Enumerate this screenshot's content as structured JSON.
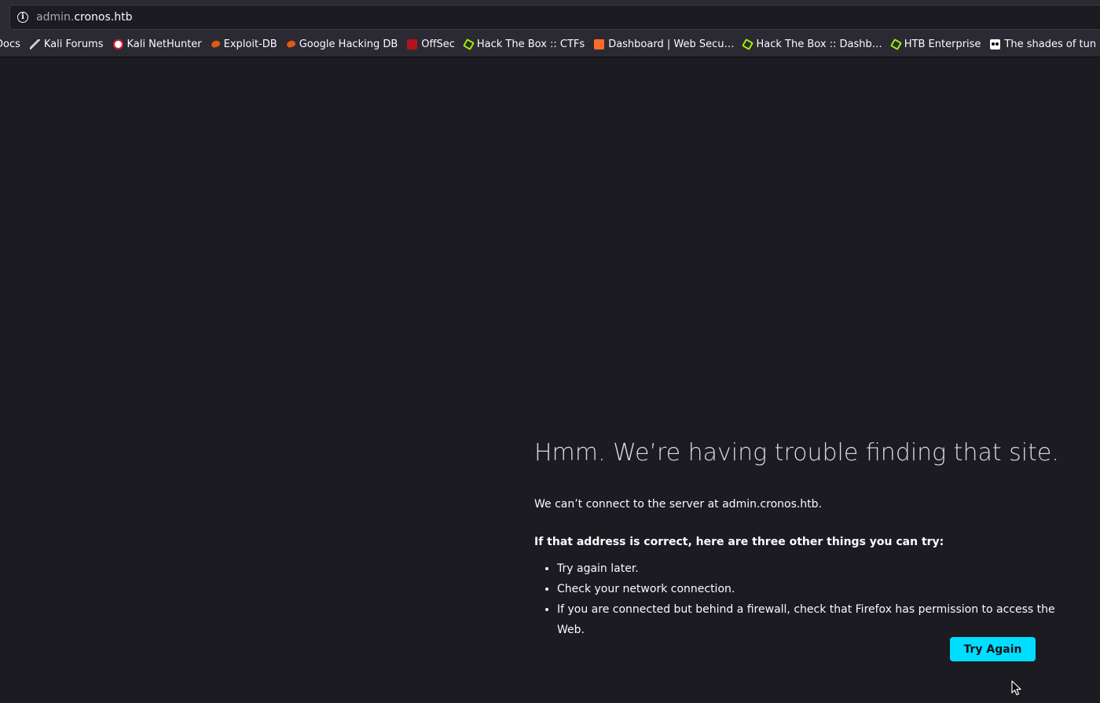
{
  "browser": {
    "url_subdomain": "admin.",
    "url_domain": "cronos.htb",
    "bookmarks": [
      {
        "label": "Docs",
        "icon": "none"
      },
      {
        "label": "Kali Forums",
        "icon": "kali-dragon-icon"
      },
      {
        "label": "Kali NetHunter",
        "icon": "nethunter-icon"
      },
      {
        "label": "Exploit-DB",
        "icon": "exploitdb-bug-icon"
      },
      {
        "label": "Google Hacking DB",
        "icon": "exploitdb-bug-icon"
      },
      {
        "label": "OffSec",
        "icon": "offsec-icon"
      },
      {
        "label": "Hack The Box :: CTFs",
        "icon": "htb-cube-icon"
      },
      {
        "label": "Dashboard | Web Secu…",
        "icon": "bolt-icon"
      },
      {
        "label": "Hack The Box :: Dashb…",
        "icon": "htb-cube-icon"
      },
      {
        "label": "HTB Enterprise",
        "icon": "htb-cube-icon"
      },
      {
        "label": "The shades of tun",
        "icon": "medium-dots-icon"
      }
    ]
  },
  "error_page": {
    "title": "Hmm. We’re having trouble finding that site.",
    "description": "We can’t connect to the server at admin.cronos.htb.",
    "suggestions_heading": "If that address is correct, here are three other things you can try:",
    "suggestions": [
      "Try again later.",
      "Check your network connection.",
      "If you are connected but behind a firewall, check that Firefox has permission to access the Web."
    ],
    "try_again_label": "Try Again"
  },
  "colors": {
    "page_background": "#1c1b22",
    "toolbar_background": "#2b2a33",
    "button_accent": "#00ddff"
  }
}
